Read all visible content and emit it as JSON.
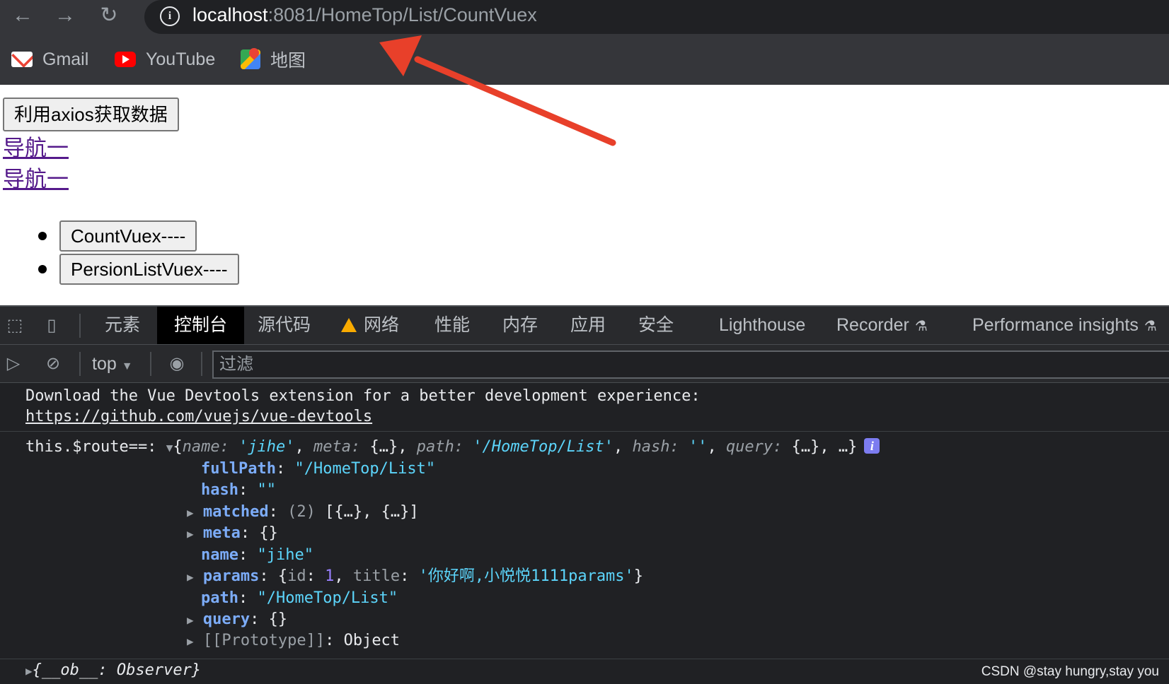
{
  "browser": {
    "url_host": "localhost",
    "url_rest": ":8081/HomeTop/List/CountVuex",
    "bookmarks": [
      {
        "label": "Gmail",
        "icon": "gmail-icon"
      },
      {
        "label": "YouTube",
        "icon": "youtube-icon"
      },
      {
        "label": "地图",
        "icon": "maps-icon"
      }
    ]
  },
  "page": {
    "axios_button": "利用axios获取数据",
    "nav_links": [
      "导航一",
      "导航一"
    ],
    "list_buttons": [
      "CountVuex----",
      "PersionListVuex----"
    ]
  },
  "devtools": {
    "tabs": [
      "元素",
      "控制台",
      "源代码",
      "网络",
      "性能",
      "内存",
      "应用",
      "安全",
      "Lighthouse",
      "Recorder",
      "Performance insights"
    ],
    "active_tab": "控制台",
    "context": "top",
    "filter_placeholder": "过滤",
    "console": {
      "msg1_line1": "Download the Vue Devtools extension for a better development experience:",
      "msg1_link": "https://github.com/vuejs/vue-devtools",
      "log_label": "this.$route==:",
      "summary": {
        "open": "{",
        "name_key": "name",
        "name_val": "'jihe'",
        "meta_key": "meta",
        "meta_val": "{…}",
        "path_key": "path",
        "path_val": "'/HomeTop/List'",
        "hash_key": "hash",
        "hash_val": "''",
        "query_key": "query",
        "query_val": "{…}",
        "close": "…}"
      },
      "props": {
        "fullPath_key": "fullPath",
        "fullPath_val": "\"/HomeTop/List\"",
        "hash_key": "hash",
        "hash_val": "\"\"",
        "matched_key": "matched",
        "matched_count": "(2)",
        "matched_val": "[{…}, {…}]",
        "meta_key": "meta",
        "meta_val": "{}",
        "name_key": "name",
        "name_val": "\"jihe\"",
        "params_key": "params",
        "params_id_key": "id",
        "params_id_val": "1",
        "params_title_key": "title",
        "params_title_val": "'你好啊,小悦悦1111params'",
        "path_key": "path",
        "path_val": "\"/HomeTop/List\"",
        "query_key": "query",
        "query_val": "{}",
        "proto_key": "[[Prototype]]",
        "proto_val": "Object"
      },
      "last_line": "{__ob__: Observer}"
    }
  },
  "watermark": "CSDN @stay hungry,stay you",
  "colors": {
    "arrow": "#e8402a",
    "link": "#551a8b",
    "accent": "#7cacf8"
  }
}
